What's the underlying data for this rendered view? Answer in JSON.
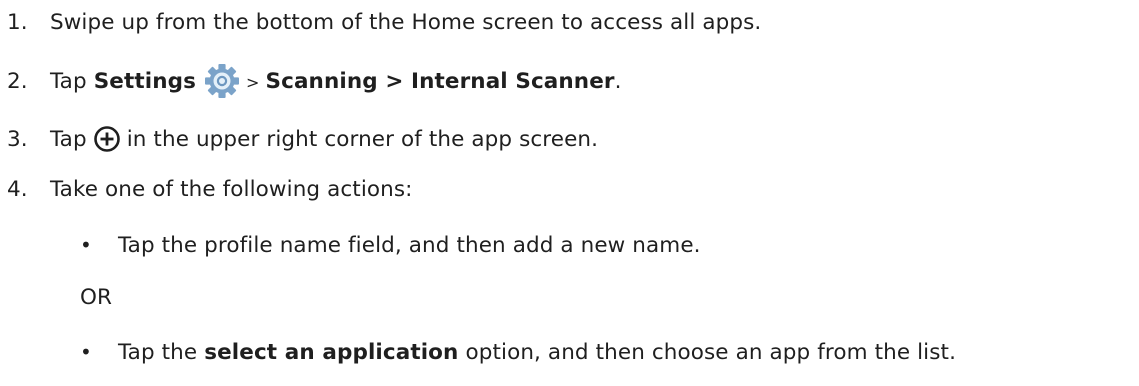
{
  "steps": [
    {
      "number": "1.",
      "text": "Swipe up from the bottom of the Home screen to access all apps."
    },
    {
      "number": "2.",
      "tap": "Tap",
      "settings": "Settings",
      "separator": ">",
      "path": "Scanning > Internal Scanner",
      "end": "."
    },
    {
      "number": "3.",
      "tap": "Tap",
      "text": "in the upper right corner of the app screen."
    },
    {
      "number": "4.",
      "text": "Take one of the following actions:"
    }
  ],
  "actions": {
    "bullet": "•",
    "first": "Tap the profile name field, and then add a new name.",
    "or": "OR",
    "second_pre": "Tap the",
    "second_bold": "select an application",
    "second_post": "option, and then choose an app from the list."
  },
  "icons": {
    "settings": "settings-gear-icon",
    "add": "add-circle-plus-icon"
  },
  "colors": {
    "text": "#1f1f1f",
    "gear_outer": "#7ba3c9",
    "gear_inner": "#e4f0f9"
  }
}
